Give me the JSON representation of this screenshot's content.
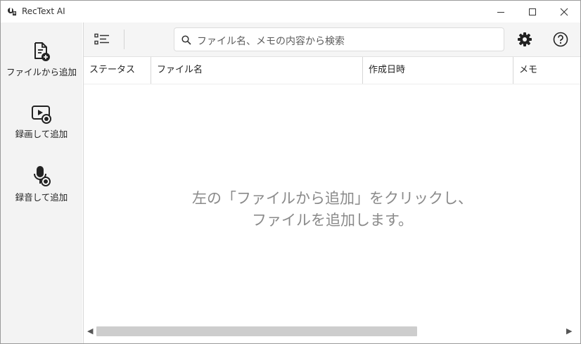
{
  "window": {
    "title": "RecText AI"
  },
  "sidebar": {
    "items": [
      {
        "label": "ファイルから追加",
        "icon": "file-add-icon"
      },
      {
        "label": "録画して追加",
        "icon": "video-record-icon"
      },
      {
        "label": "録音して追加",
        "icon": "mic-record-icon"
      }
    ]
  },
  "toolbar": {
    "list_icon": "list-view-icon",
    "search_placeholder": "ファイル名、メモの内容から検索",
    "settings_icon": "gear-icon",
    "help_icon": "help-icon"
  },
  "table": {
    "columns": [
      "ステータス",
      "ファイル名",
      "作成日時",
      "メモ"
    ],
    "rows": []
  },
  "empty_state": {
    "line1": "左の「ファイルから追加」をクリックし、",
    "line2": "ファイルを追加します。"
  }
}
